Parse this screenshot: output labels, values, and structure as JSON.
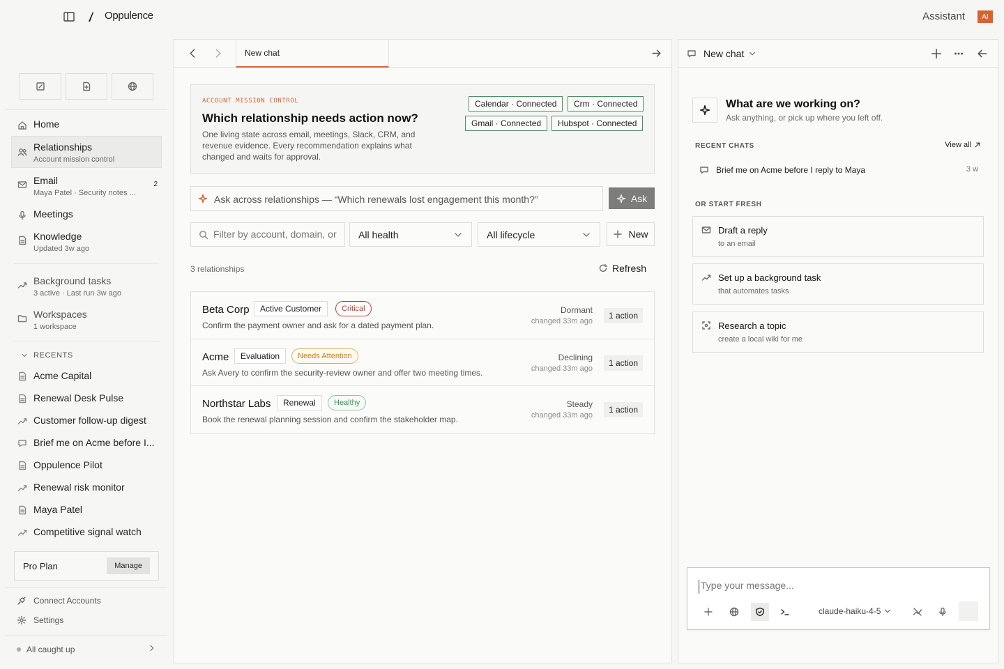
{
  "app": {
    "brand": "Oppulence",
    "assistant_label": "Assistant",
    "ai_badge": "AI"
  },
  "sidebar": {
    "nav": [
      {
        "label": "Home",
        "sub": ""
      },
      {
        "label": "Relationships",
        "sub": "Account mission control"
      },
      {
        "label": "Email",
        "sub": "Maya Patel · Security notes ...",
        "badge": "2"
      },
      {
        "label": "Meetings",
        "sub": ""
      },
      {
        "label": "Knowledge",
        "sub": "Updated 3w ago"
      },
      {
        "label": "Background tasks",
        "sub": "3 active · Last run 3w ago"
      },
      {
        "label": "Workspaces",
        "sub": "1 workspace"
      }
    ],
    "recents_label": "RECENTS",
    "recents": [
      "Acme Capital",
      "Renewal Desk Pulse",
      "Customer follow-up digest",
      "Brief me on Acme before I...",
      "Oppulence Pilot",
      "Renewal risk monitor",
      "Maya Patel",
      "Competitive signal watch"
    ],
    "plan": {
      "name": "Pro Plan",
      "manage": "Manage"
    },
    "connect_accounts": "Connect Accounts",
    "settings": "Settings",
    "status": "All caught up"
  },
  "center": {
    "tab": "New chat",
    "hero": {
      "kicker": "ACCOUNT MISSION CONTROL",
      "title": "Which relationship needs action now?",
      "description": "One living state across email, meetings, Slack, CRM, and revenue evidence. Every recommendation explains what changed and waits for approval.",
      "connections": [
        "Calendar · Connected",
        "Crm · Connected",
        "Gmail · Connected",
        "Hubspot · Connected"
      ]
    },
    "ask": {
      "placeholder": "Ask across relationships — “Which renewals lost engagement this month?”",
      "button": "Ask"
    },
    "filter": {
      "placeholder": "Filter by account, domain, or owner",
      "health": "All health",
      "lifecycle": "All lifecycle",
      "new": "New"
    },
    "count": "3 relationships",
    "refresh": "Refresh",
    "relationships": [
      {
        "name": "Beta Corp",
        "stage": "Active Customer",
        "health": "Critical",
        "summary": "Confirm the payment owner and ask for a dated payment plan.",
        "trend": "Dormant",
        "changed": "changed 33m ago",
        "action": "1 action"
      },
      {
        "name": "Acme",
        "stage": "Evaluation",
        "health": "Needs Attention",
        "summary": "Ask Avery to confirm the security-review owner and offer two meeting times.",
        "trend": "Declining",
        "changed": "changed 33m ago",
        "action": "1 action"
      },
      {
        "name": "Northstar Labs",
        "stage": "Renewal",
        "health": "Healthy",
        "summary": "Book the renewal planning session and confirm the stakeholder map.",
        "trend": "Steady",
        "changed": "changed 33m ago",
        "action": "1 action"
      }
    ]
  },
  "assistant": {
    "title": "New chat",
    "welcome_title": "What are we working on?",
    "welcome_sub": "Ask anything, or pick up where you left off.",
    "recent_label": "RECENT CHATS",
    "view_all": "View all",
    "recent_chats": [
      {
        "label": "Brief me on Acme before I reply to Maya",
        "age": "3 w"
      }
    ],
    "start_label": "OR START FRESH",
    "start_cards": [
      {
        "title": "Draft a reply",
        "sub": "to an email"
      },
      {
        "title": "Set up a background task",
        "sub": "that automates tasks"
      },
      {
        "title": "Research a topic",
        "sub": "create a local wiki for me"
      }
    ],
    "composer": {
      "placeholder": "Type your message...",
      "model": "claude-haiku-4-5"
    }
  },
  "colors": {
    "accent": "#d8632f",
    "critical": "#c0392b",
    "attention": "#d08a1e",
    "healthy": "#3f8f5a",
    "connected": "#4f8f62"
  }
}
